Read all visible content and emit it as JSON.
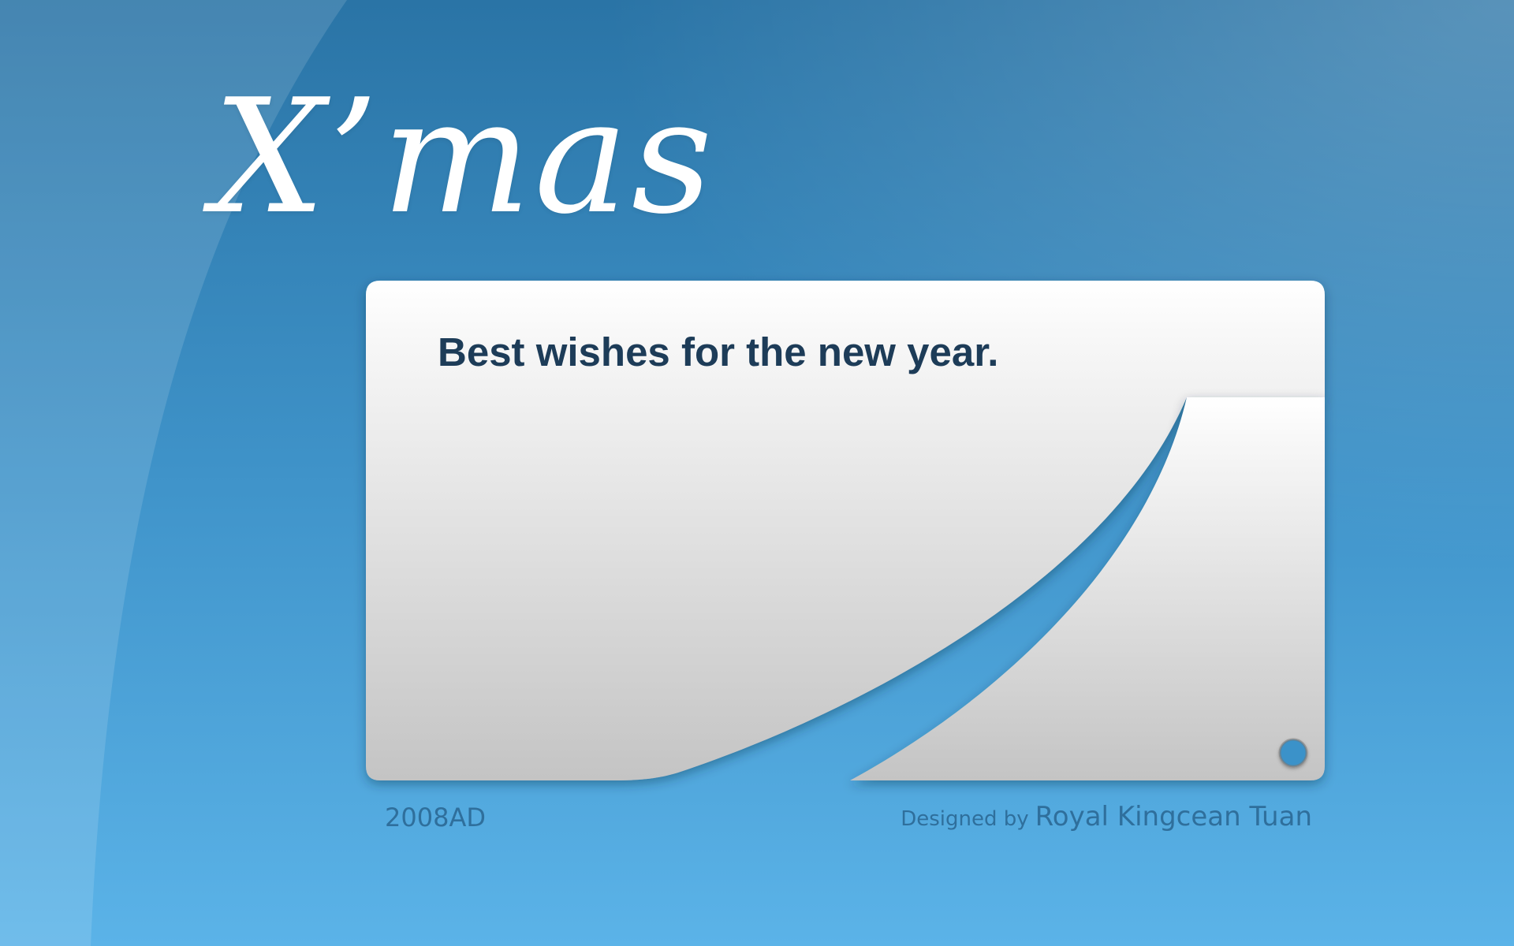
{
  "wallpaper": {
    "title": "X’mas",
    "message": "Best wishes for the new year.",
    "year": "2008AD",
    "credit_prefix": "Designed by",
    "credit_name": "Royal Kingcean Tuan"
  },
  "colors": {
    "background_top": "#2a74a6",
    "background_bottom": "#5bb3e8",
    "card_top": "#ffffff",
    "card_bottom": "#c4c4c4",
    "message_text": "#1d3c58",
    "footer_text": "#2f6f9c"
  }
}
